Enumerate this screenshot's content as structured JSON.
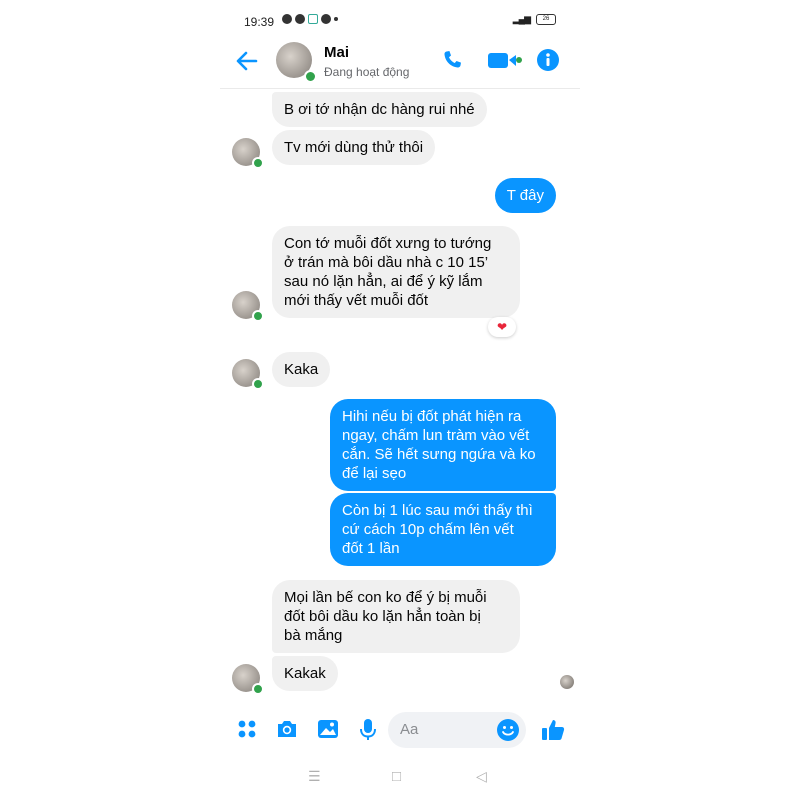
{
  "status_bar": {
    "time": "19:39",
    "battery": "26"
  },
  "header": {
    "contact_name": "Mai",
    "activity": "Đang hoạt động"
  },
  "colors": {
    "accent": "#0a95ff",
    "online": "#31a24c",
    "incoming_bubble": "#f0f0f0"
  },
  "messages": [
    {
      "direction": "in",
      "text": "B ơi tớ nhận dc hàng rui nhé"
    },
    {
      "direction": "in",
      "text": "Tv mới dùng thử thôi"
    },
    {
      "direction": "out",
      "text": "T đây"
    },
    {
      "direction": "in",
      "text": "Con tớ muỗi đốt xưng to tướng\nở trán mà bôi dầu nhà c 10 15’\nsau nó lặn hẳn, ai để ý kỹ lắm\nmới thấy vết muỗi đốt",
      "reaction": "heart"
    },
    {
      "direction": "in",
      "text": "Kaka"
    },
    {
      "direction": "out",
      "text": "Hihi nếu bị đốt phát hiện ra\nngay, chấm lun tràm vào vết\ncắn. Sẽ hết sưng ngứa và ko\nđể lại sẹo"
    },
    {
      "direction": "out",
      "text": "Còn bị 1 lúc sau mới thấy thì\ncứ cách 10p chấm lên vết\nđốt 1 lần"
    },
    {
      "direction": "in",
      "text": "Mọi lần bế con ko để ý bị muỗi\nđốt bôi dầu ko lặn hẳn toàn bị\nbà mắng"
    },
    {
      "direction": "in",
      "text": "Kakak"
    }
  ],
  "composer": {
    "placeholder": "Aa",
    "icons": [
      "menu-dots-icon",
      "camera-icon",
      "gallery-icon",
      "microphone-icon",
      "emoji-icon",
      "thumbs-up-icon"
    ]
  },
  "nav_bar": {
    "icons": [
      "recents-icon",
      "home-icon",
      "back-icon"
    ]
  }
}
